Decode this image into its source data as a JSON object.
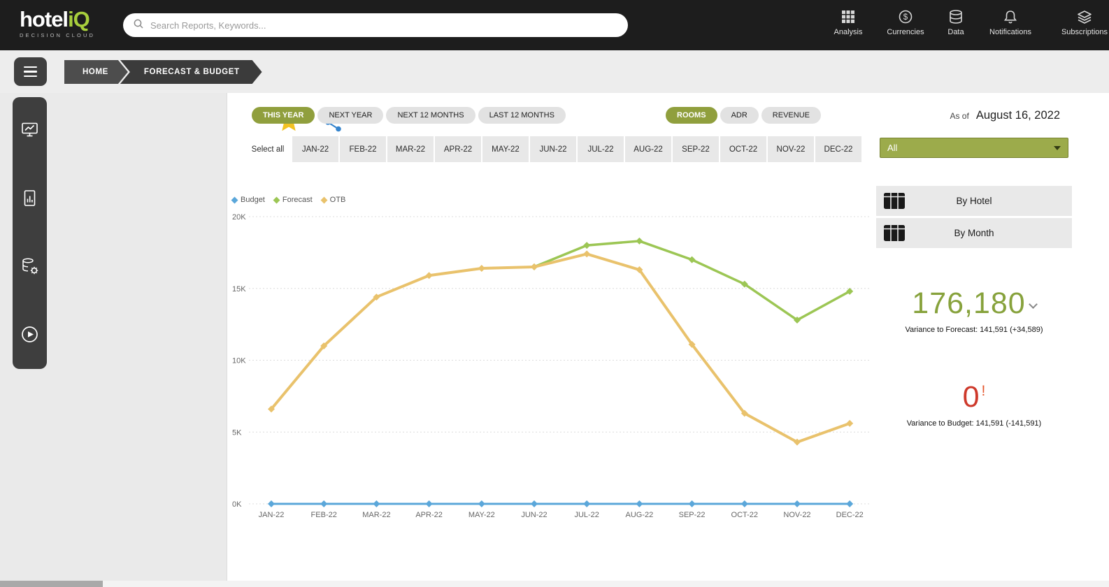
{
  "topbar": {
    "logo": {
      "text_primary": "hotel",
      "text_accent": "iQ",
      "subtitle": "DECISION CLOUD",
      "accent_color": "#a8cf3d"
    },
    "search": {
      "placeholder": "Search Reports, Keywords..."
    },
    "nav": [
      {
        "label": "Analysis"
      },
      {
        "label": "Currencies"
      },
      {
        "label": "Data"
      },
      {
        "label": "Notifications"
      },
      {
        "label": "Subscriptions"
      }
    ]
  },
  "breadcrumb": {
    "items": [
      "HOME",
      "FORECAST & BUDGET"
    ]
  },
  "controls": {
    "period_tabs": [
      "THIS YEAR",
      "NEXT YEAR",
      "NEXT 12 MONTHS",
      "LAST 12 MONTHS"
    ],
    "active_period": "THIS YEAR",
    "metric_tabs": [
      "ROOMS",
      "ADR",
      "REVENUE"
    ],
    "active_metric": "ROOMS",
    "active_color": "#909f3d",
    "as_of_label": "As of",
    "as_of_date": "August 16, 2022",
    "months": [
      "Select all",
      "JAN-22",
      "FEB-22",
      "MAR-22",
      "APR-22",
      "MAY-22",
      "JUN-22",
      "JUL-22",
      "AUG-22",
      "SEP-22",
      "OCT-22",
      "NOV-22",
      "DEC-22"
    ],
    "filter_dropdown_value": "All"
  },
  "chart_data": {
    "type": "line",
    "categories": [
      "JAN-22",
      "FEB-22",
      "MAR-22",
      "APR-22",
      "MAY-22",
      "JUN-22",
      "JUL-22",
      "AUG-22",
      "SEP-22",
      "OCT-22",
      "NOV-22",
      "DEC-22"
    ],
    "series": [
      {
        "name": "Budget",
        "color": "#5ba7da",
        "values": [
          0,
          0,
          0,
          0,
          0,
          0,
          0,
          0,
          0,
          0,
          0,
          0
        ]
      },
      {
        "name": "Forecast",
        "color": "#9cc654",
        "values": [
          null,
          null,
          null,
          null,
          null,
          16500,
          18000,
          18300,
          17000,
          15300,
          12800,
          14800
        ]
      },
      {
        "name": "OTB",
        "color": "#e9c26c",
        "values": [
          6600,
          11000,
          14400,
          15900,
          16400,
          16500,
          17400,
          16300,
          11100,
          6300,
          4300,
          5600
        ]
      }
    ],
    "ylim": [
      0,
      20000
    ],
    "yticks": [
      "0K",
      "5K",
      "10K",
      "15K",
      "20K"
    ],
    "grid": "horizontal-dashed",
    "legend_position": "top-left",
    "xlabel": "",
    "ylabel": ""
  },
  "summary": {
    "by_hotel_label": "By Hotel",
    "by_month_label": "By Month",
    "big_value": "176,180",
    "big_value_color": "#87a23c",
    "variance_forecast": "Variance to Forecast: 141,591 (+34,589)",
    "zero_value": "0",
    "zero_color": "#ce392b",
    "variance_budget": "Variance to Budget: 141,591 (-141,591)"
  }
}
